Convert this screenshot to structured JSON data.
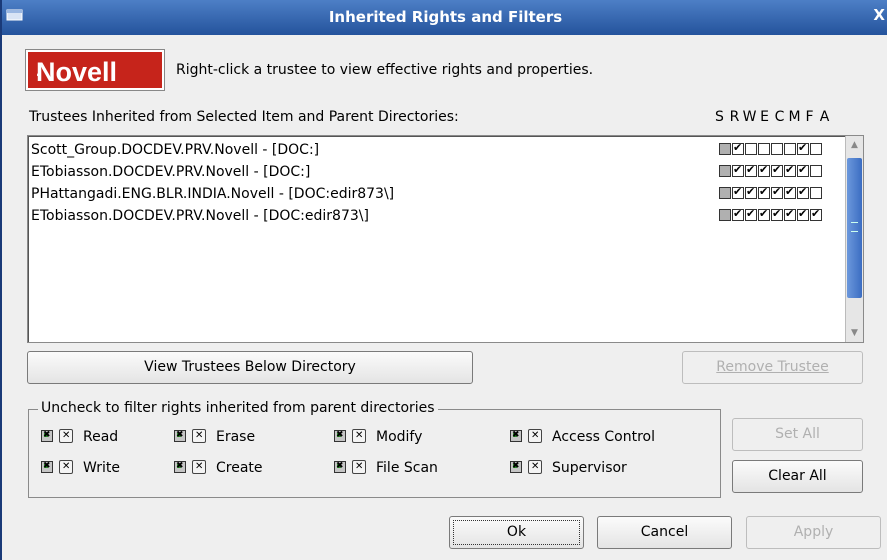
{
  "window": {
    "title": "Inherited Rights and Filters",
    "close_glyph": "X"
  },
  "logo": {
    "text": "Novell",
    "mark": "."
  },
  "hint": "Right-click a trustee to view effective rights and properties.",
  "trustees_label": "Trustees Inherited from Selected Item and Parent Directories:",
  "rights_columns": [
    "S",
    "R",
    "W",
    "E",
    "C",
    "M",
    "F",
    "A"
  ],
  "trustees": [
    {
      "name": "Scott_Group.DOCDEV.PRV.Novell - [DOC:]",
      "rights": [
        false,
        true,
        false,
        false,
        false,
        false,
        true,
        false
      ]
    },
    {
      "name": "ETobiasson.DOCDEV.PRV.Novell - [DOC:]",
      "rights": [
        false,
        true,
        true,
        true,
        true,
        true,
        true,
        false
      ]
    },
    {
      "name": "PHattangadi.ENG.BLR.INDIA.Novell - [DOC:edir873\\]",
      "rights": [
        false,
        true,
        true,
        true,
        true,
        true,
        true,
        false
      ]
    },
    {
      "name": "ETobiasson.DOCDEV.PRV.Novell - [DOC:edir873\\]",
      "rights": [
        false,
        true,
        true,
        true,
        true,
        true,
        true,
        true
      ]
    }
  ],
  "buttons": {
    "view_trustees": "View Trustees Below Directory",
    "remove_trustee": "Remove Trustee",
    "set_all": "Set All",
    "clear_all": "Clear All",
    "ok": "Ok",
    "cancel": "Cancel",
    "apply": "Apply"
  },
  "filter_group": {
    "legend": "Uncheck to filter rights inherited from parent directories",
    "items": [
      {
        "label": "Read",
        "checked": true
      },
      {
        "label": "Erase",
        "checked": true
      },
      {
        "label": "Modify",
        "checked": true
      },
      {
        "label": "Access Control",
        "checked": true
      },
      {
        "label": "Write",
        "checked": true
      },
      {
        "label": "Create",
        "checked": true
      },
      {
        "label": "File Scan",
        "checked": true
      },
      {
        "label": "Supervisor",
        "checked": true
      }
    ]
  },
  "colors": {
    "title_bar": "#2f5fab",
    "logo_red": "#c6241b",
    "scroll_thumb": "#4a7dcc"
  }
}
